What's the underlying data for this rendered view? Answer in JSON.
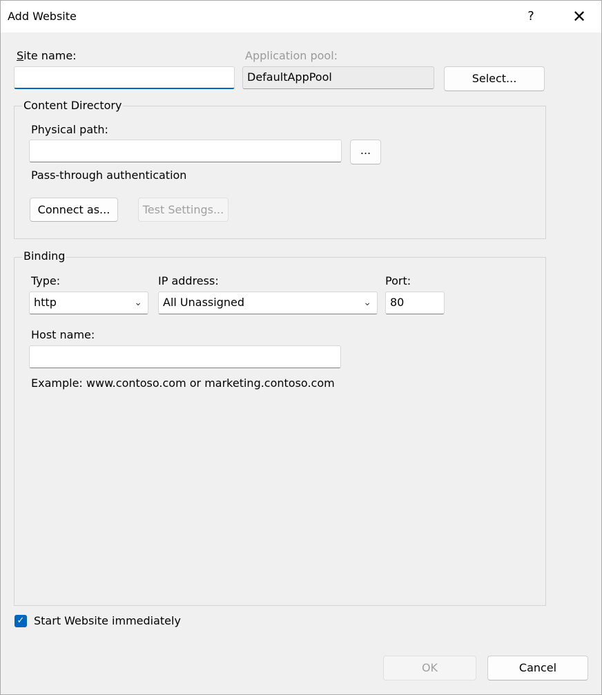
{
  "window": {
    "title": "Add Website",
    "help_glyph": "?",
    "close_glyph": "✕"
  },
  "site": {
    "site_name_label": "Site name:",
    "site_name_value": "",
    "app_pool_label": "Application pool:",
    "app_pool_value": "DefaultAppPool",
    "select_button": "Select..."
  },
  "content_directory": {
    "group_title": "Content Directory",
    "physical_path_label": "Physical path:",
    "physical_path_value": "",
    "browse_button": "...",
    "pass_through_label": "Pass-through authentication",
    "connect_as_button": "Connect as...",
    "test_settings_button": "Test Settings..."
  },
  "binding": {
    "group_title": "Binding",
    "type_label": "Type:",
    "type_value": "http",
    "ip_label": "IP address:",
    "ip_value": "All Unassigned",
    "port_label": "Port:",
    "port_value": "80",
    "host_label": "Host name:",
    "host_value": "",
    "example_text": "Example: www.contoso.com or marketing.contoso.com"
  },
  "start_immediately": {
    "label": "Start Website immediately",
    "checked": true
  },
  "footer": {
    "ok_button": "OK",
    "cancel_button": "Cancel"
  },
  "colors": {
    "accent": "#0067c0",
    "background": "#f0f0f0"
  }
}
